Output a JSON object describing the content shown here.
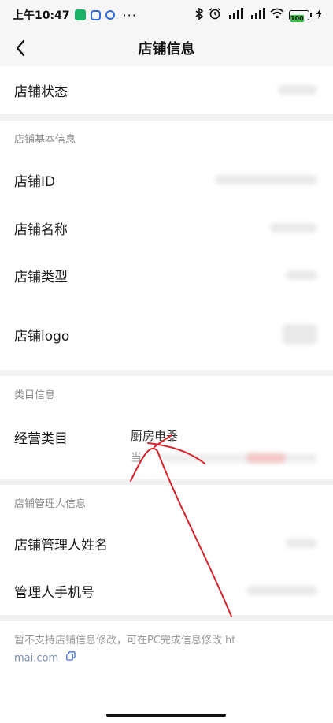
{
  "status_bar": {
    "time": "上午10:47",
    "battery_text": "100",
    "more": "···"
  },
  "nav": {
    "title": "店铺信息"
  },
  "rows": {
    "store_status": "店铺状态",
    "store_id": "店铺ID",
    "store_name": "店铺名称",
    "store_type": "店铺类型",
    "store_logo": "店铺logo",
    "business_category": "经营类目",
    "business_category_value": "厨房电器",
    "manager_name": "店铺管理人姓名",
    "manager_phone": "管理人手机号"
  },
  "sections": {
    "basic": "店铺基本信息",
    "category": "类目信息",
    "manager": "店铺管理人信息"
  },
  "partial_text": {
    "category_sub": "当"
  },
  "footer": {
    "note_line1": "暂不支持店铺信息修改，可在PC完成信息修改 ht",
    "note_line2": "mai.com"
  },
  "colors": {
    "annotation": "#d8232a",
    "link": "#4a6fd1"
  }
}
